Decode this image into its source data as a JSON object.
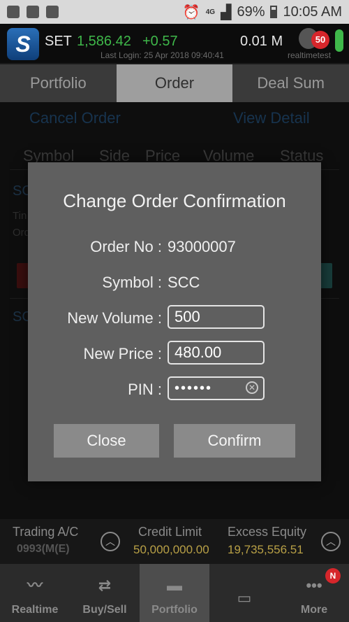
{
  "status_bar": {
    "network": "4G",
    "battery": "69%",
    "time": "10:05 AM"
  },
  "header": {
    "logo": "S",
    "index_name": "SET",
    "index_value": "1,586.42",
    "index_change": "+0.57",
    "volume": "0.01 M",
    "last_login": "Last Login: 25 Apr 2018 09:40:41",
    "notification_count": "50",
    "username": "realtimetest"
  },
  "tabs": [
    {
      "label": "Portfolio"
    },
    {
      "label": "Order"
    },
    {
      "label": "Deal Sum"
    }
  ],
  "actions": {
    "cancel_order": "Cancel Order",
    "view_detail": "View Detail"
  },
  "columns": [
    "Symbol",
    "Side",
    "Price",
    "Volume",
    "Status"
  ],
  "dialog": {
    "title": "Change Order Confirmation",
    "order_no_label": "Order No :",
    "order_no": "93000007",
    "symbol_label": "Symbol :",
    "symbol": "SCC",
    "new_volume_label": "New Volume :",
    "new_volume": "500",
    "new_price_label": "New Price :",
    "new_price": "480.00",
    "pin_label": "PIN :",
    "pin": "••••••",
    "close_label": "Close",
    "confirm_label": "Confirm"
  },
  "summary": {
    "trading_label": "Trading A/C",
    "account": "0993(M(E)",
    "credit_label": "Credit Limit",
    "credit_value": "50,000,000.00",
    "excess_label": "Excess Equity",
    "excess_value": "19,735,556.51"
  },
  "bottom_nav": [
    {
      "label": "Realtime"
    },
    {
      "label": "Buy/Sell"
    },
    {
      "label": "Portfolio"
    },
    {
      "label": ""
    },
    {
      "label": "More",
      "badge": "N"
    }
  ],
  "colors": {
    "accent_green": "#3fb84a",
    "badge_red": "#d6262b",
    "link_blue": "#2a5e8e",
    "gold": "#b8a046"
  }
}
